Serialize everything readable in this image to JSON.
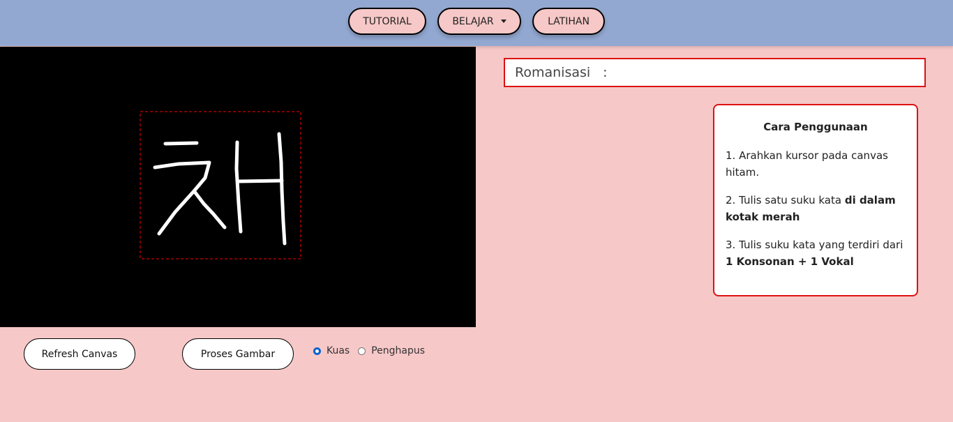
{
  "nav": {
    "tutorial": "TUTORIAL",
    "belajar": "BELAJAR",
    "latihan": "LATIHAN"
  },
  "canvas": {
    "background": "#000000",
    "guide_box_color": "#cc0000",
    "stroke_color": "#ffffff"
  },
  "controls": {
    "refresh_label": "Refresh Canvas",
    "proses_label": "Proses Gambar",
    "tool_options": [
      {
        "label": "Kuas",
        "checked": true
      },
      {
        "label": "Penghapus",
        "checked": false
      }
    ]
  },
  "romanisasi": {
    "label": "Romanisasi",
    "separator": ":",
    "value": ""
  },
  "instructions": {
    "title": "Cara Penggunaan",
    "step1": "1. Arahkan kursor pada canvas hitam.",
    "step2_prefix": "2. Tulis satu suku kata ",
    "step2_bold": "di dalam kotak merah",
    "step3_prefix": "3. Tulis suku kata yang terdiri dari ",
    "step3_bold": "1 Konsonan + 1 Vokal"
  },
  "colors": {
    "navbar": "#93a8d1",
    "page_background": "#f7c8c8",
    "accent_red": "#dd1111",
    "radio_selected": "#0b63ce"
  }
}
